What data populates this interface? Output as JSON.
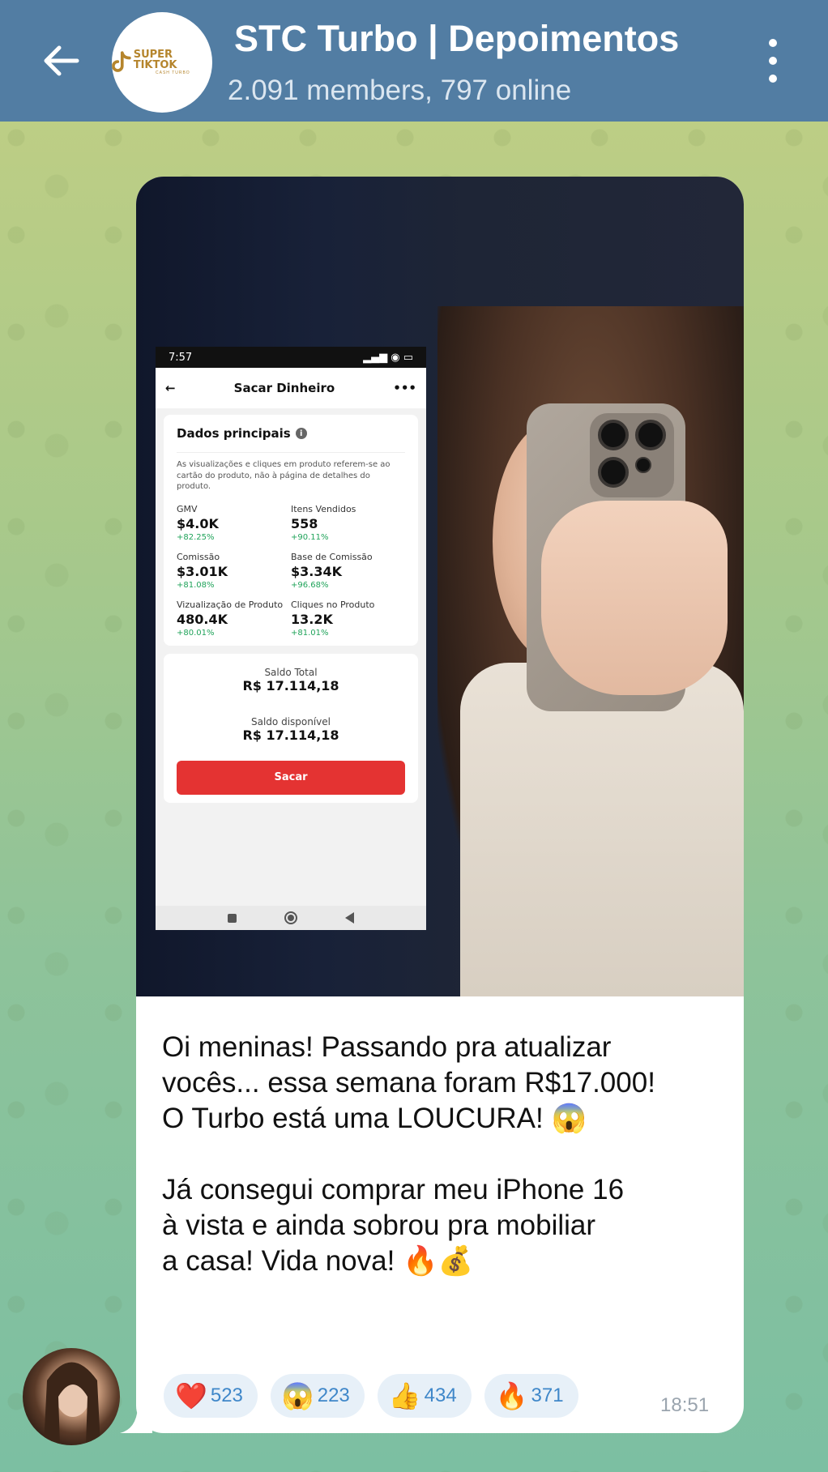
{
  "header": {
    "title": "STC Turbo | Depoimentos",
    "subtitle": "2.091 members, 797 online",
    "logo_text": "SUPER TIKTOK",
    "logo_sub": "CASH TURBO"
  },
  "screenshot": {
    "status_time": "7:57",
    "status_icons": "...",
    "appbar_title": "Sacar Dinheiro",
    "appbar_more": "•••",
    "section_title": "Dados principais",
    "description": "As visualizações e cliques em produto referem-se ao cartão do produto, não à página de detalhes do produto.",
    "metrics": [
      {
        "label": "GMV",
        "value": "$4.0K",
        "change": "+82.25%"
      },
      {
        "label": "Itens Vendidos",
        "value": "558",
        "change": "+90.11%"
      },
      {
        "label": "Comissão",
        "value": "$3.01K",
        "change": "+81.08%"
      },
      {
        "label": "Base de Comissão",
        "value": "$3.34K",
        "change": "+96.68%"
      },
      {
        "label": "Vizualização de Produto",
        "value": "480.4K",
        "change": "+80.01%"
      },
      {
        "label": "Cliques no Produto",
        "value": "13.2K",
        "change": "+81.01%"
      }
    ],
    "saldo_total_label": "Saldo Total",
    "saldo_total_value": "R$ 17.114,18",
    "saldo_disp_label": "Saldo disponível",
    "saldo_disp_value": "R$ 17.114,18",
    "button_label": "Sacar"
  },
  "message": {
    "text": "Oi meninas! Passando pra atualizar\nvocês... essa semana foram R$17.000!\nO Turbo está uma LOUCURA! 😱\n\nJá consegui comprar meu iPhone 16\nà vista e ainda sobrou pra mobiliar\na casa! Vida nova! 🔥💰",
    "time": "18:51"
  },
  "reactions": [
    {
      "emoji": "❤️",
      "count": "523"
    },
    {
      "emoji": "😱",
      "count": "223"
    },
    {
      "emoji": "👍",
      "count": "434"
    },
    {
      "emoji": "🔥",
      "count": "371"
    }
  ],
  "colors": {
    "header_bg": "#527da3",
    "reaction_count": "#3f87c9",
    "sacar_button": "#e43332",
    "positive_change": "#20a35a"
  }
}
